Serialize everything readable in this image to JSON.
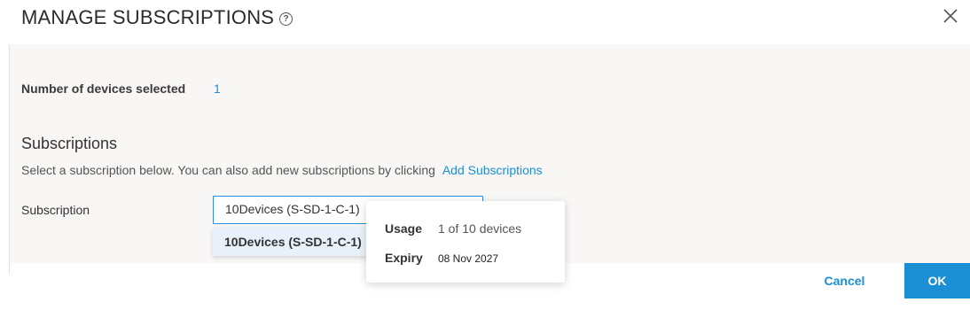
{
  "dialog": {
    "title": "MANAGE SUBSCRIPTIONS",
    "help_icon": "question-circle-icon",
    "close_icon": "close-icon"
  },
  "devices": {
    "label": "Number of devices selected",
    "count": "1"
  },
  "subscriptions": {
    "heading": "Subscriptions",
    "description": "Select a subscription below. You can also add new subscriptions by clicking",
    "add_link": "Add Subscriptions",
    "field_label": "Subscription",
    "selected_value": "10Devices (S-SD-1-C-1)",
    "options": [
      "10Devices (S-SD-1-C-1)"
    ]
  },
  "tooltip": {
    "usage_label": "Usage",
    "usage_value": "1 of 10 devices",
    "expiry_label": "Expiry",
    "expiry_value": "08 Nov 2027"
  },
  "footer": {
    "cancel_label": "Cancel",
    "ok_label": "OK"
  },
  "colors": {
    "accent": "#1a8fd4",
    "panel_bg": "#f8f7f6",
    "option_highlight": "#e8f1f9"
  }
}
